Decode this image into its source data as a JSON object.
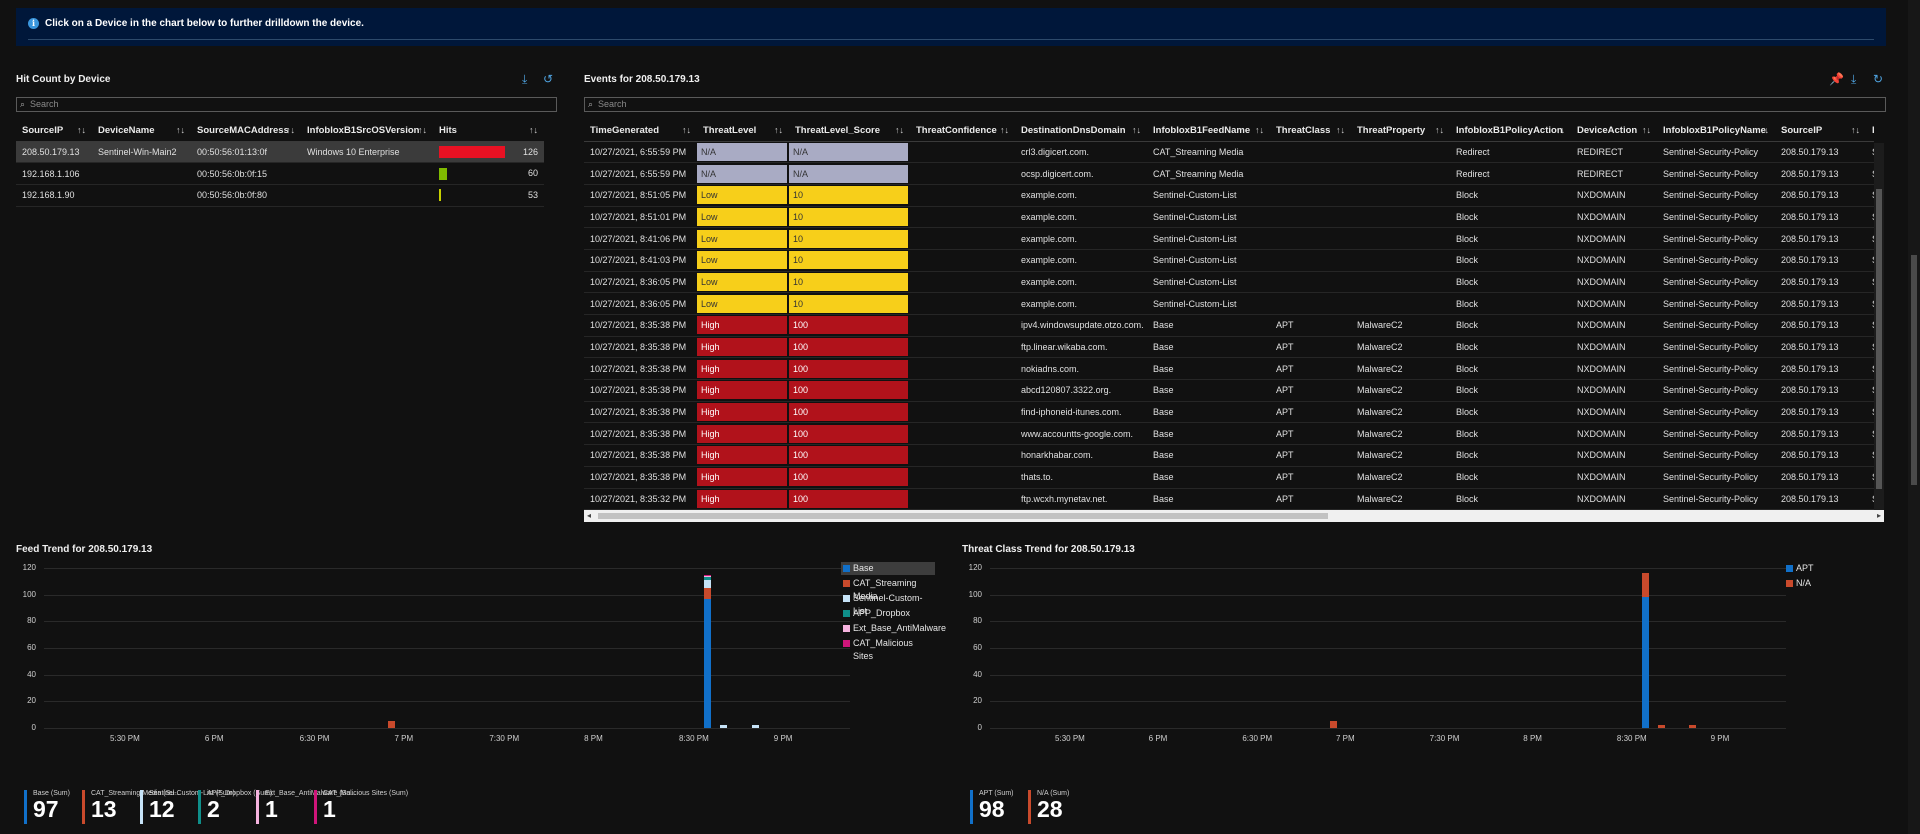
{
  "banner": {
    "message": "Click on a Device in the chart below to further drilldown the device."
  },
  "hit_count": {
    "title": "Hit Count by Device",
    "search_placeholder": "Search",
    "columns": [
      "SourceIP",
      "DeviceName",
      "SourceMACAddress",
      "InfobloxB1SrcOSVersion",
      "Hits"
    ],
    "rows": [
      {
        "ip": "208.50.179.13",
        "device": "Sentinel-Win-Main2",
        "mac": "00:50:56:01:13:0f",
        "os": "Windows 10 Enterprise",
        "hits": "126",
        "bar_fraction": 1.0,
        "bar_color": "#e81123",
        "selected": true
      },
      {
        "ip": "192.168.1.106",
        "device": "",
        "mac": "00:50:56:0b:0f:15",
        "os": "",
        "hits": "60",
        "bar_fraction": 0.12,
        "bar_color": "#7fba00",
        "selected": false
      },
      {
        "ip": "192.168.1.90",
        "device": "",
        "mac": "00:50:56:0b:0f:80",
        "os": "",
        "hits": "53",
        "bar_fraction": 0.02,
        "bar_color": "#c6d000",
        "selected": false
      }
    ]
  },
  "events": {
    "title": "Events for 208.50.179.13",
    "search_placeholder": "Search",
    "columns": [
      "TimeGenerated",
      "ThreatLevel",
      "ThreatLevel_Score",
      "ThreatConfidence",
      "DestinationDnsDomain",
      "InfobloxB1FeedName",
      "ThreatClass",
      "ThreatProperty",
      "InfobloxB1PolicyAction",
      "DeviceAction",
      "InfobloxB1PolicyName",
      "SourceIP",
      "Devi"
    ],
    "rows": [
      [
        "10/27/2021, 6:55:59 PM",
        "N/A",
        "N/A",
        "",
        "crl3.digicert.com.",
        "CAT_Streaming Media",
        "",
        "",
        "Redirect",
        "REDIRECT",
        "Sentinel-Security-Policy",
        "208.50.179.13",
        "S"
      ],
      [
        "10/27/2021, 6:55:59 PM",
        "N/A",
        "N/A",
        "",
        "ocsp.digicert.com.",
        "CAT_Streaming Media",
        "",
        "",
        "Redirect",
        "REDIRECT",
        "Sentinel-Security-Policy",
        "208.50.179.13",
        "S"
      ],
      [
        "10/27/2021, 8:51:05 PM",
        "Low",
        "10",
        "",
        "example.com.",
        "Sentinel-Custom-List",
        "",
        "",
        "Block",
        "NXDOMAIN",
        "Sentinel-Security-Policy",
        "208.50.179.13",
        "S"
      ],
      [
        "10/27/2021, 8:51:01 PM",
        "Low",
        "10",
        "",
        "example.com.",
        "Sentinel-Custom-List",
        "",
        "",
        "Block",
        "NXDOMAIN",
        "Sentinel-Security-Policy",
        "208.50.179.13",
        "S"
      ],
      [
        "10/27/2021, 8:41:06 PM",
        "Low",
        "10",
        "",
        "example.com.",
        "Sentinel-Custom-List",
        "",
        "",
        "Block",
        "NXDOMAIN",
        "Sentinel-Security-Policy",
        "208.50.179.13",
        "S"
      ],
      [
        "10/27/2021, 8:41:03 PM",
        "Low",
        "10",
        "",
        "example.com.",
        "Sentinel-Custom-List",
        "",
        "",
        "Block",
        "NXDOMAIN",
        "Sentinel-Security-Policy",
        "208.50.179.13",
        "S"
      ],
      [
        "10/27/2021, 8:36:05 PM",
        "Low",
        "10",
        "",
        "example.com.",
        "Sentinel-Custom-List",
        "",
        "",
        "Block",
        "NXDOMAIN",
        "Sentinel-Security-Policy",
        "208.50.179.13",
        "S"
      ],
      [
        "10/27/2021, 8:36:05 PM",
        "Low",
        "10",
        "",
        "example.com.",
        "Sentinel-Custom-List",
        "",
        "",
        "Block",
        "NXDOMAIN",
        "Sentinel-Security-Policy",
        "208.50.179.13",
        "S"
      ],
      [
        "10/27/2021, 8:35:38 PM",
        "High",
        "100",
        "",
        "ipv4.windowsupdate.otzo.com.",
        "Base",
        "APT",
        "MalwareC2",
        "Block",
        "NXDOMAIN",
        "Sentinel-Security-Policy",
        "208.50.179.13",
        "S"
      ],
      [
        "10/27/2021, 8:35:38 PM",
        "High",
        "100",
        "",
        "ftp.linear.wikaba.com.",
        "Base",
        "APT",
        "MalwareC2",
        "Block",
        "NXDOMAIN",
        "Sentinel-Security-Policy",
        "208.50.179.13",
        "S"
      ],
      [
        "10/27/2021, 8:35:38 PM",
        "High",
        "100",
        "",
        "nokiadns.com.",
        "Base",
        "APT",
        "MalwareC2",
        "Block",
        "NXDOMAIN",
        "Sentinel-Security-Policy",
        "208.50.179.13",
        "S"
      ],
      [
        "10/27/2021, 8:35:38 PM",
        "High",
        "100",
        "",
        "abcd120807.3322.org.",
        "Base",
        "APT",
        "MalwareC2",
        "Block",
        "NXDOMAIN",
        "Sentinel-Security-Policy",
        "208.50.179.13",
        "S"
      ],
      [
        "10/27/2021, 8:35:38 PM",
        "High",
        "100",
        "",
        "find-iphoneid-itunes.com.",
        "Base",
        "APT",
        "MalwareC2",
        "Block",
        "NXDOMAIN",
        "Sentinel-Security-Policy",
        "208.50.179.13",
        "S"
      ],
      [
        "10/27/2021, 8:35:38 PM",
        "High",
        "100",
        "",
        "www.accountts-google.com.",
        "Base",
        "APT",
        "MalwareC2",
        "Block",
        "NXDOMAIN",
        "Sentinel-Security-Policy",
        "208.50.179.13",
        "S"
      ],
      [
        "10/27/2021, 8:35:38 PM",
        "High",
        "100",
        "",
        "honarkhabar.com.",
        "Base",
        "APT",
        "MalwareC2",
        "Block",
        "NXDOMAIN",
        "Sentinel-Security-Policy",
        "208.50.179.13",
        "S"
      ],
      [
        "10/27/2021, 8:35:38 PM",
        "High",
        "100",
        "",
        "thats.to.",
        "Base",
        "APT",
        "MalwareC2",
        "Block",
        "NXDOMAIN",
        "Sentinel-Security-Policy",
        "208.50.179.13",
        "S"
      ],
      [
        "10/27/2021, 8:35:32 PM",
        "High",
        "100",
        "",
        "ftp.wcxh.mynetav.net.",
        "Base",
        "APT",
        "MalwareC2",
        "Block",
        "NXDOMAIN",
        "Sentinel-Security-Policy",
        "208.50.179.13",
        "S"
      ]
    ]
  },
  "chart_data": [
    {
      "type": "bar",
      "title": "Feed Trend for 208.50.179.13",
      "x_ticks": [
        "5:30 PM",
        "6 PM",
        "6:30 PM",
        "7 PM",
        "7:30 PM",
        "8 PM",
        "8:30 PM",
        "9 PM"
      ],
      "ylim": [
        0,
        120
      ],
      "y_ticks": [
        "120",
        "100",
        "80",
        "60",
        "40",
        "20",
        "0"
      ],
      "legend": [
        "Base",
        "CAT_Streaming Media",
        "Sentinel-Custom-List",
        "APP_Dropbox",
        "Ext_Base_AntiMalware",
        "CAT_Malicious Sites"
      ],
      "colors": [
        "#1170c9",
        "#c94a2c",
        "#c6e3f7",
        "#0f8f8a",
        "#f6b3df",
        "#d0157a"
      ],
      "stacks": [
        {
          "x": "6:55 PM",
          "values": [
            0,
            5,
            0,
            0,
            0,
            0
          ]
        },
        {
          "x": "8:35 PM",
          "values": [
            97,
            8,
            6,
            2,
            1,
            1
          ]
        },
        {
          "x": "8:40 PM",
          "values": [
            0,
            0,
            2,
            0,
            0,
            0
          ]
        },
        {
          "x": "8:50 PM",
          "values": [
            0,
            0,
            2,
            0,
            0,
            0
          ]
        }
      ],
      "tiles": [
        {
          "label": "Base (Sum)",
          "value": "97",
          "color": "#1170c9"
        },
        {
          "label": "CAT_Streaming Media (Su...",
          "value": "13",
          "color": "#c94a2c"
        },
        {
          "label": "Sentinel-Custom-List (Sum)",
          "value": "12",
          "color": "#c6e3f7"
        },
        {
          "label": "APP_Dropbox (Sum)",
          "value": "2",
          "color": "#0f8f8a"
        },
        {
          "label": "Ext_Base_AntiMalware (Su...",
          "value": "1",
          "color": "#f6b3df"
        },
        {
          "label": "CAT_Malicious Sites (Sum)",
          "value": "1",
          "color": "#d0157a"
        }
      ]
    },
    {
      "type": "bar",
      "title": "Threat Class Trend for 208.50.179.13",
      "x_ticks": [
        "5:30 PM",
        "6 PM",
        "6:30 PM",
        "7 PM",
        "7:30 PM",
        "8 PM",
        "8:30 PM",
        "9 PM"
      ],
      "ylim": [
        0,
        120
      ],
      "y_ticks": [
        "120",
        "100",
        "80",
        "60",
        "40",
        "20",
        "0"
      ],
      "legend": [
        "APT",
        "N/A"
      ],
      "colors": [
        "#1170c9",
        "#c94a2c"
      ],
      "stacks": [
        {
          "x": "6:55 PM",
          "values": [
            0,
            5
          ]
        },
        {
          "x": "8:35 PM",
          "values": [
            98,
            18
          ]
        },
        {
          "x": "8:40 PM",
          "values": [
            0,
            2
          ]
        },
        {
          "x": "8:50 PM",
          "values": [
            0,
            2
          ]
        }
      ],
      "tiles": [
        {
          "label": "APT (Sum)",
          "value": "98",
          "color": "#1170c9"
        },
        {
          "label": "N/A (Sum)",
          "value": "28",
          "color": "#c94a2c"
        }
      ]
    }
  ]
}
